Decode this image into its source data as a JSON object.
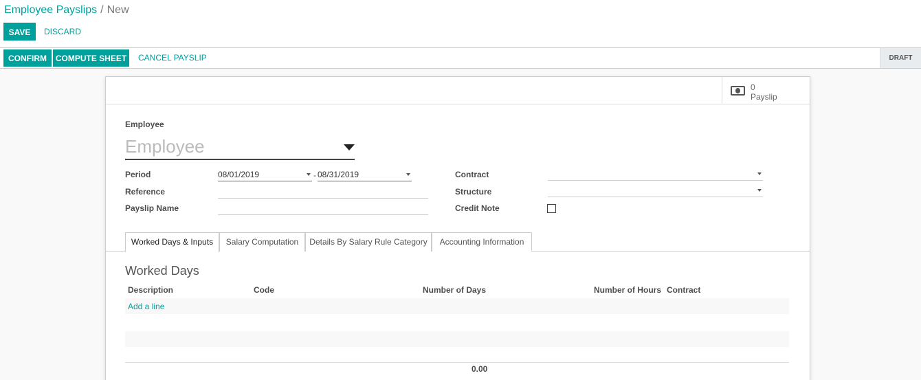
{
  "breadcrumb": {
    "parent": "Employee Payslips",
    "separator": "/",
    "current": "New"
  },
  "toolbar": {
    "save_label": "SAVE",
    "discard_label": "DISCARD"
  },
  "statusbar": {
    "confirm_label": "CONFIRM",
    "compute_label": "COMPUTE SHEET",
    "cancel_label": "CANCEL PAYSLIP",
    "status": "DRAFT"
  },
  "stat_button": {
    "value": "0",
    "label": "Payslip",
    "icon": "money-icon"
  },
  "form": {
    "employee_label": "Employee",
    "employee_placeholder": "Employee",
    "period_label": "Period",
    "period_from": "08/01/2019",
    "period_separator": "-",
    "period_to": "08/31/2019",
    "reference_label": "Reference",
    "reference_value": "",
    "payslip_name_label": "Payslip Name",
    "payslip_name_value": "",
    "contract_label": "Contract",
    "contract_value": "",
    "structure_label": "Structure",
    "structure_value": "",
    "credit_note_label": "Credit Note",
    "credit_note_checked": false
  },
  "tabs": [
    {
      "label": "Worked Days & Inputs",
      "active": true
    },
    {
      "label": "Salary Computation",
      "active": false
    },
    {
      "label": "Details By Salary Rule Category",
      "active": false
    },
    {
      "label": "Accounting Information",
      "active": false
    }
  ],
  "worked_days": {
    "title": "Worked Days",
    "columns": [
      "Description",
      "Code",
      "Number of Days",
      "Number of Hours",
      "Contract"
    ],
    "add_line_label": "Add a line",
    "total_days": "0.00"
  },
  "colors": {
    "accent": "#00a09d",
    "draft_bg": "#e9ecef"
  }
}
